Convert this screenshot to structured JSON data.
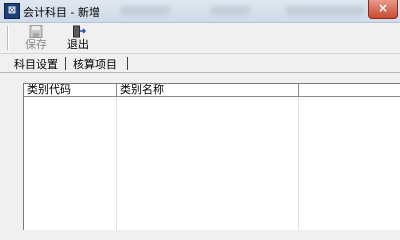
{
  "window": {
    "title": "会计科目 - 新增",
    "close_glyph": "×"
  },
  "toolbar": {
    "items": [
      {
        "label": "保存",
        "icon": "save-icon",
        "enabled": false
      },
      {
        "label": "退出",
        "icon": "exit-icon",
        "enabled": true
      }
    ]
  },
  "tabs": [
    {
      "label": "科目设置",
      "active": false
    },
    {
      "label": "核算项目",
      "active": true
    }
  ],
  "grid": {
    "columns": [
      "类别代码",
      "类别名称",
      ""
    ],
    "rows": []
  },
  "colors": {
    "title_bar": "#cfdae8",
    "close_button": "#c8492f",
    "grid_bg": "#ffffff"
  }
}
